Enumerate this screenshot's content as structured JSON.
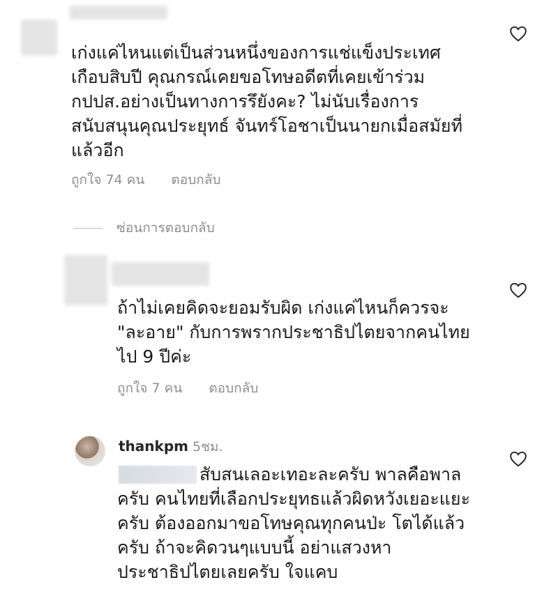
{
  "comments": [
    {
      "text_lines": [
        "เก่งแค่ไหนแต่เป็นส่วนหนึ่งของการแช่แข็งประเทศ",
        "เกือบสิบปี คุณกรณ์เคยขอโทษอดีตที่เคยเข้าร่วม",
        "กปปส.อย่างเป็นทางการรึยังคะ? ไม่นับเรื่องการ",
        "สนับสนุนคุณประยุทธ์ จันทร์โอชาเป็นนายกเมื่อสมัยที่",
        "แล้วอีก"
      ],
      "likes": "ถูกใจ 74 คน",
      "reply": "ตอบกลับ"
    },
    {
      "text_lines": [
        "ถ้าไม่เคยคิดจะยอมรับผิด เก่งแค่ไหนก็ควรจะ",
        "\"ละอาย\" กับการพรากประชาธิปไตยจากคนไทย",
        "ไป 9 ปีค่ะ"
      ],
      "likes": "ถูกใจ 7 คน",
      "reply": "ตอบกลับ"
    },
    {
      "username": "thankpm",
      "time": "5ชม.",
      "text_lines": [
        "สับสนเลอะเทอะละครับ พาลคือพาล",
        "ครับ คนไทยที่เลือกประยุทธแล้วผิดหวังเยอะแยะ",
        "ครับ ต้องออกมาขอโทษคุณทุกคนป่ะ โตได้แล้ว",
        "ครับ ถ้าจะคิดวนๆแบบนี้ อย่าแสวงหา",
        "ประชาธิปไตยเลยครับ ใจแคบ"
      ]
    }
  ],
  "hide_replies": "ซ่อนการตอบกลับ"
}
